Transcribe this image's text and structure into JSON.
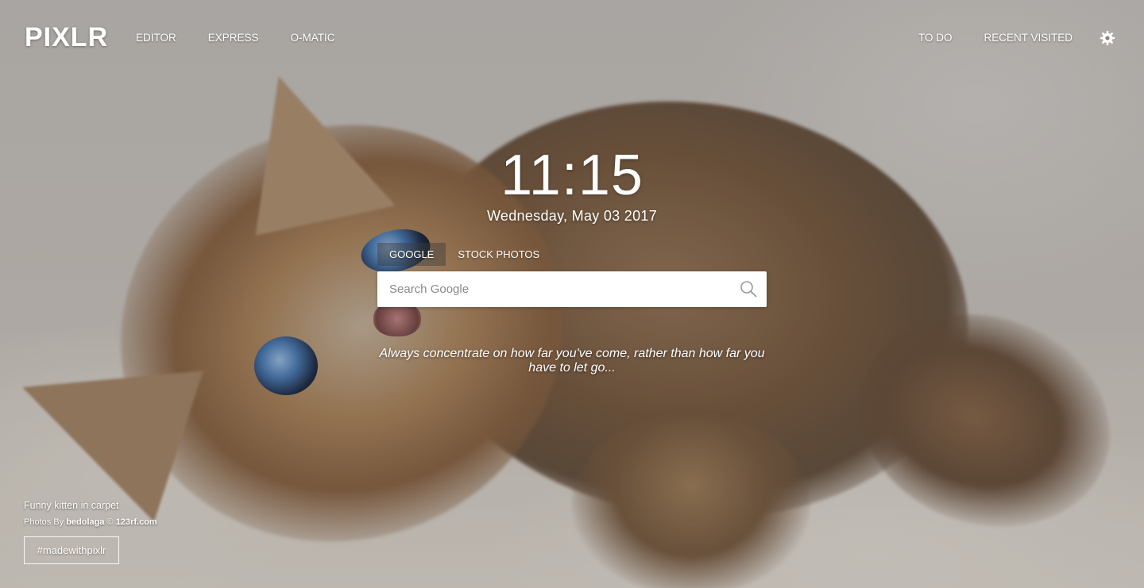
{
  "header": {
    "logo": "PIXLR",
    "nav_left": [
      "EDITOR",
      "EXPRESS",
      "O-MATIC"
    ],
    "nav_right": [
      "TO DO",
      "RECENT VISITED"
    ],
    "settings_icon": "gear-icon"
  },
  "clock": {
    "time": "11:15",
    "date": "Wednesday, May 03 2017"
  },
  "search": {
    "tabs": [
      "GOOGLE",
      "STOCK PHOTOS"
    ],
    "active_tab": "GOOGLE",
    "placeholder": "Search Google",
    "value": "",
    "icon": "search-icon"
  },
  "quote": "Always concentrate on how far you've come, rather than how far you have to let go...",
  "photo": {
    "title": "Funny kitten in carpet",
    "credit_prefix": "Photos By ",
    "author": "bedolaga",
    "credit_sep": " © ",
    "source": "123rf.com"
  },
  "hashtag": "#madewithpixlr",
  "colors": {
    "text": "#ffffff",
    "search_bg": "#ffffff",
    "active_tab_bg": "rgba(60,60,60,0.45)"
  }
}
